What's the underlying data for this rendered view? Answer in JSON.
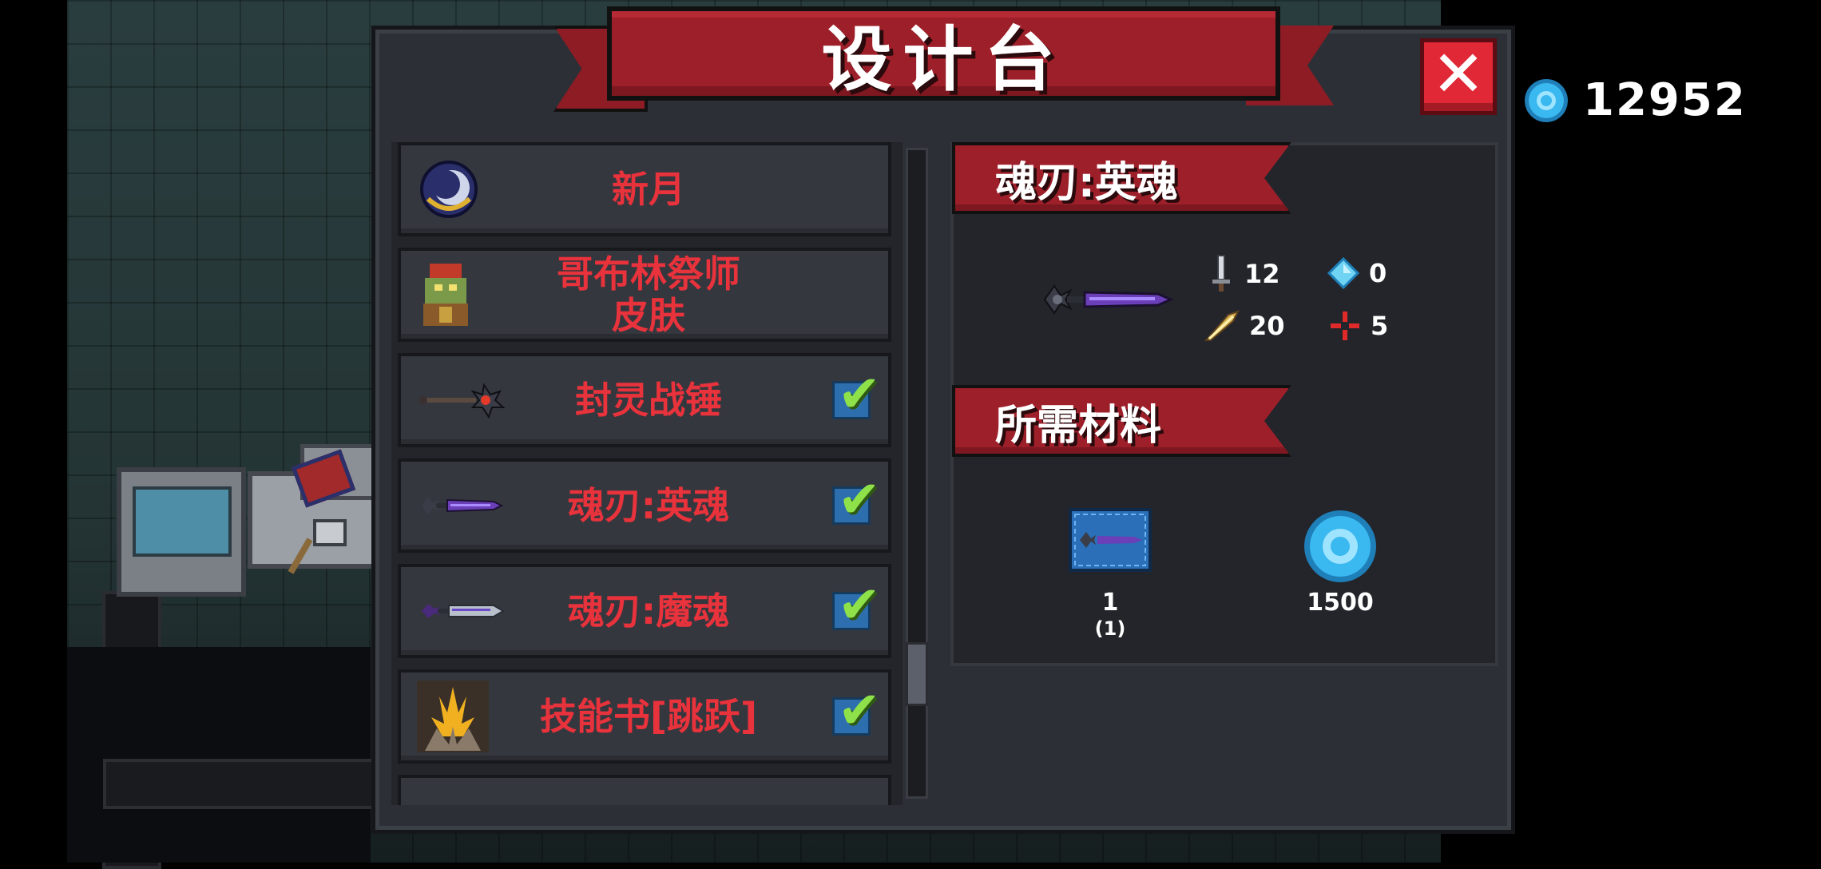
{
  "title": "设计台",
  "currency": {
    "amount": "12952"
  },
  "list_items": [
    {
      "label": "新月",
      "checked": false,
      "icon": "crescent-moon-icon"
    },
    {
      "label": "哥布林祭师\n皮肤",
      "checked": false,
      "icon": "goblin-priest-icon"
    },
    {
      "label": "封灵战锤",
      "checked": true,
      "icon": "war-hammer-icon"
    },
    {
      "label": "魂刃:英魂",
      "checked": true,
      "icon": "soul-blade-hero-icon"
    },
    {
      "label": "魂刃:魔魂",
      "checked": true,
      "icon": "soul-blade-demon-icon"
    },
    {
      "label": "技能书[跳跃]",
      "checked": true,
      "icon": "skill-book-jump-icon"
    }
  ],
  "detail": {
    "name": "魂刃:英魂",
    "stats": {
      "attack": "12",
      "energy": "0",
      "crit": "20",
      "accuracy": "5"
    },
    "materials_title": "所需材料",
    "materials": [
      {
        "icon": "blueprint-icon",
        "count": "1",
        "owned": "(1)"
      },
      {
        "icon": "gem-icon",
        "count": "1500"
      }
    ]
  },
  "colors": {
    "accent_red": "#9c1f29",
    "label_red": "#e8323c",
    "check_green": "#8fe14a",
    "gem_blue": "#3ab8f0"
  }
}
